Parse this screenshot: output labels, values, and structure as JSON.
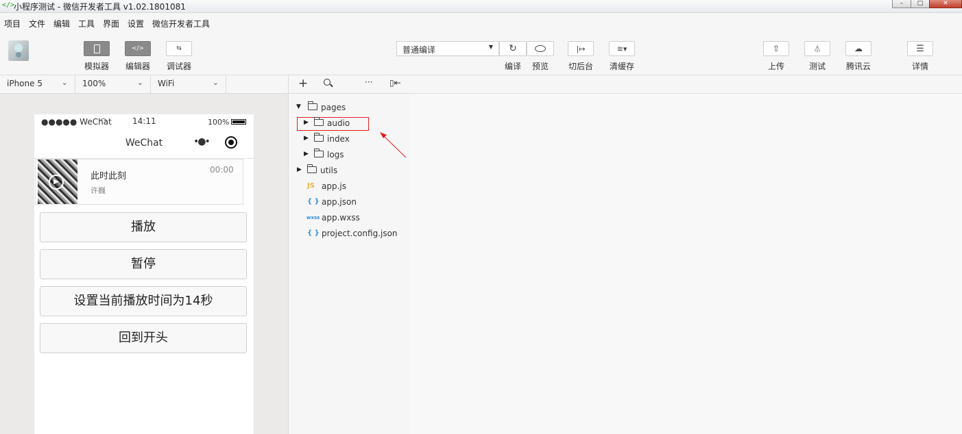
{
  "window": {
    "title": "小程序测试 - 微信开发者工具 v1.02.1801081",
    "controls": [
      "minimize",
      "maximize",
      "close"
    ]
  },
  "menu": [
    "项目",
    "文件",
    "编辑",
    "工具",
    "界面",
    "设置",
    "微信开发者工具"
  ],
  "toolbar": {
    "simulator_label": "模拟器",
    "editor_label": "编辑器",
    "debugger_label": "调试器",
    "compile_mode": "普通编译",
    "compile_label": "编译",
    "preview_label": "预览",
    "background_label": "切后台",
    "clear_cache_label": "清缓存",
    "upload_label": "上传",
    "test_label": "测试",
    "cloud_label": "腾讯云",
    "details_label": "详情"
  },
  "device_bar": {
    "device": "iPhone 5",
    "zoom": "100%",
    "network": "WiFi"
  },
  "phone": {
    "status": {
      "carrier": "●●●●● WeChat",
      "time": "14:11",
      "battery": "100%"
    },
    "nav_title": "WeChat",
    "audio": {
      "name": "此时此刻",
      "author": "许巍",
      "time": "00:00"
    },
    "buttons": [
      "播放",
      "暂停",
      "设置当前播放时间为14秒",
      "回到开头"
    ]
  },
  "file_tree": {
    "items": [
      {
        "name": "pages",
        "type": "folder",
        "expanded": true
      },
      {
        "name": "audio",
        "type": "folder",
        "expanded": false,
        "highlighted": true
      },
      {
        "name": "index",
        "type": "folder",
        "expanded": false
      },
      {
        "name": "logs",
        "type": "folder",
        "expanded": false
      },
      {
        "name": "utils",
        "type": "folder",
        "expanded": false
      },
      {
        "name": "app.js",
        "type": "js",
        "icon": "JS"
      },
      {
        "name": "app.json",
        "type": "json",
        "icon": "{ }"
      },
      {
        "name": "app.wxss",
        "type": "wxss",
        "icon": "wxss"
      },
      {
        "name": "project.config.json",
        "type": "json",
        "icon": "{ }"
      }
    ]
  },
  "colors": {
    "highlight_box": "#e02020",
    "annotation_arrow": "#e02020",
    "js_icon": "#e8b33c",
    "json_icon": "#2d8fd5",
    "wxss_icon": "#2d8fd5"
  }
}
